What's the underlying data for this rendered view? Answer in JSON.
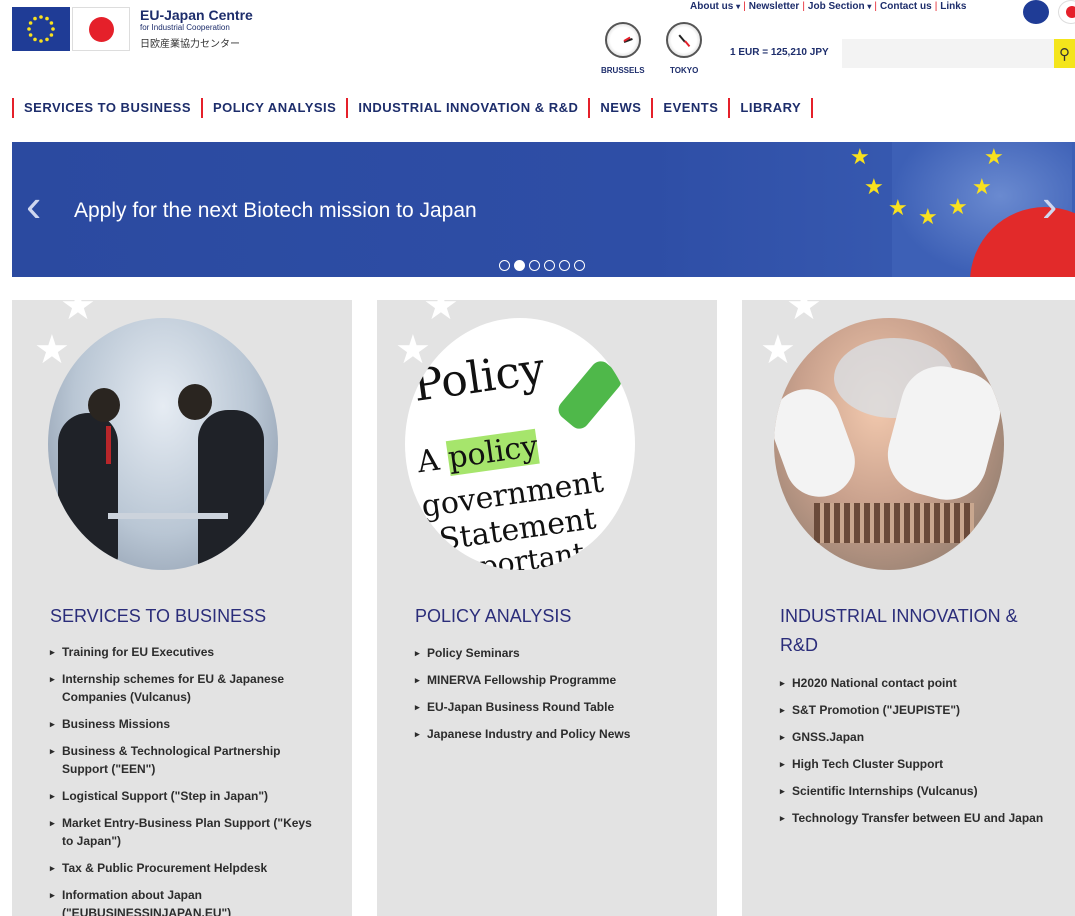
{
  "brand": {
    "name": "EU-Japan Centre",
    "subtitle_line1": "for Industrial Cooperation",
    "japanese": "日欧産業協力センター"
  },
  "toplinks": {
    "about": "About us",
    "newsletter": "Newsletter",
    "jobs": "Job Section",
    "contact": "Contact us",
    "links": "Links"
  },
  "clocks": {
    "brussels": "BRUSSELS",
    "tokyo": "TOKYO"
  },
  "exchange_rate": "1 EUR = 125,210 JPY",
  "search": {
    "placeholder": "",
    "value": ""
  },
  "nav": [
    "SERVICES TO BUSINESS",
    "POLICY ANALYSIS",
    "INDUSTRIAL INNOVATION & R&D",
    "NEWS",
    "EVENTS",
    "LIBRARY"
  ],
  "banner": {
    "text": "Apply for the next Biotech mission to Japan",
    "slide_count": 6,
    "active_slide": 2
  },
  "colors": {
    "brand_blue": "#1d2d6b",
    "accent_red": "#e5202a",
    "banner_blue": "#2e4ea6",
    "card_bg": "#e3e3e3",
    "search_yellow": "#f4e51b"
  },
  "cards": [
    {
      "title": "SERVICES TO BUSINESS",
      "items": [
        "Training for EU Executives",
        "Internship schemes for EU & Japanese Companies (Vulcanus)",
        "Business Missions",
        "Business & Technological Partnership Support (\"EEN\")",
        "Logistical Support (\"Step in Japan\")",
        "Market Entry-Business Plan Support (\"Keys to Japan\")",
        "Tax & Public Procurement Helpdesk",
        "Information about Japan (\"EUBUSINESSINJAPAN.EU\")"
      ]
    },
    {
      "title": "POLICY ANALYSIS",
      "image_words": [
        "Policy",
        "A",
        "policy",
        "government",
        "\"Statement",
        "mportant"
      ],
      "items": [
        "Policy Seminars",
        "MINERVA Fellowship Programme",
        "EU-Japan Business Round Table",
        "Japanese Industry and Policy News"
      ]
    },
    {
      "title": "INDUSTRIAL INNOVATION & R&D",
      "items": [
        "H2020 National contact point",
        "S&T Promotion (\"JEUPISTE\")",
        "GNSS.Japan",
        "High Tech Cluster Support",
        "Scientific Internships (Vulcanus)",
        "Technology Transfer between EU and Japan"
      ]
    }
  ]
}
